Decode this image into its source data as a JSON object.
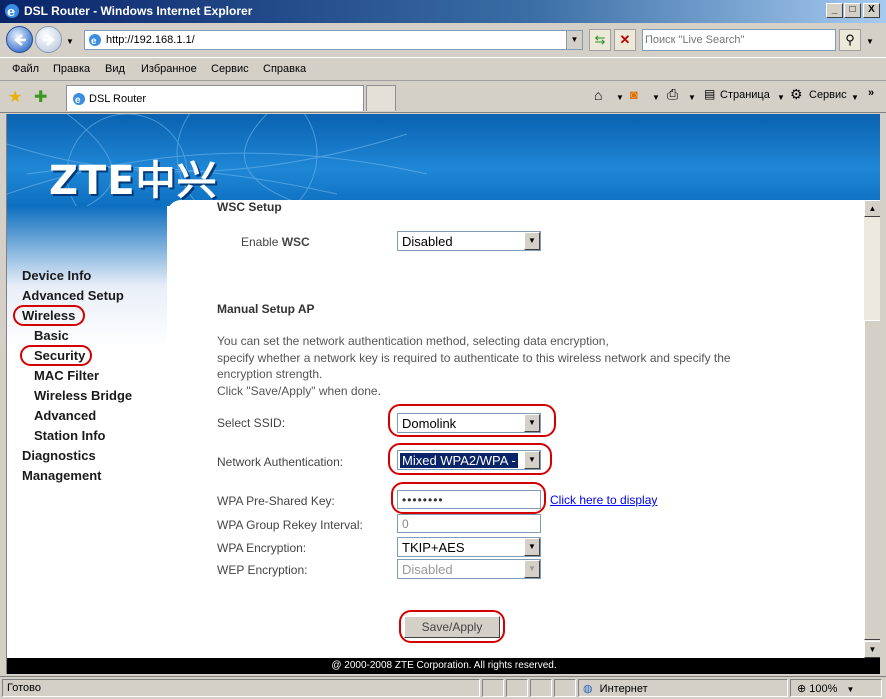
{
  "window": {
    "title": "DSL Router - Windows Internet Explorer",
    "controls": [
      "_",
      "□",
      "X"
    ]
  },
  "addressbar": {
    "url": "http://192.168.1.1/",
    "search_placeholder": "Поиск \"Live Search\""
  },
  "menu": {
    "items": [
      "Файл",
      "Правка",
      "Вид",
      "Избранное",
      "Сервис",
      "Справка"
    ]
  },
  "tabs": {
    "active_label": "DSL Router"
  },
  "commandbar": {
    "page_label": "Страница",
    "tools_label": "Сервис"
  },
  "router": {
    "brand": "ZTE中兴",
    "nav": {
      "device_info": "Device Info",
      "advanced_setup": "Advanced Setup",
      "wireless": "Wireless",
      "basic": "Basic",
      "security": "Security",
      "mac_filter": "MAC Filter",
      "wireless_bridge": "Wireless Bridge",
      "advanced": "Advanced",
      "station_info": "Station Info",
      "diagnostics": "Diagnostics",
      "management": "Management"
    },
    "wsc": {
      "title": "WSC Setup",
      "enable_label_prefix": "Enable ",
      "enable_label_strong": "WSC",
      "enable_value": "Disabled"
    },
    "manual": {
      "title": "Manual Setup AP",
      "description_lines": [
        "You can set the network authentication method, selecting data encryption,",
        "specify whether a network key is required to authenticate to this wireless network and specify the",
        "encryption strength.",
        "Click \"Save/Apply\" when done."
      ],
      "ssid_label": "Select SSID:",
      "ssid_value": "Domolink",
      "auth_label": "Network Authentication:",
      "auth_value": "Mixed WPA2/WPA -",
      "psk_label": "WPA Pre-Shared Key:",
      "psk_value": "••••••••",
      "display_link": "Click here to display",
      "rekey_label": "WPA Group Rekey Interval:",
      "rekey_value": "0",
      "wpa_enc_label": "WPA Encryption:",
      "wpa_enc_value": "TKIP+AES",
      "wep_enc_label": "WEP Encryption:",
      "wep_enc_value": "Disabled",
      "save_button": "Save/Apply"
    },
    "footer": "@ 2000-2008 ZTE Corporation. All rights reserved."
  },
  "status": {
    "left": "Готово",
    "zone": "Интернет",
    "zoom": "100%"
  },
  "colors": {
    "title_bar": "#0a246a",
    "banner": "#1f87d6",
    "highlight_ring": "#d40000",
    "selection": "#0a246a",
    "link": "#0000ee"
  }
}
